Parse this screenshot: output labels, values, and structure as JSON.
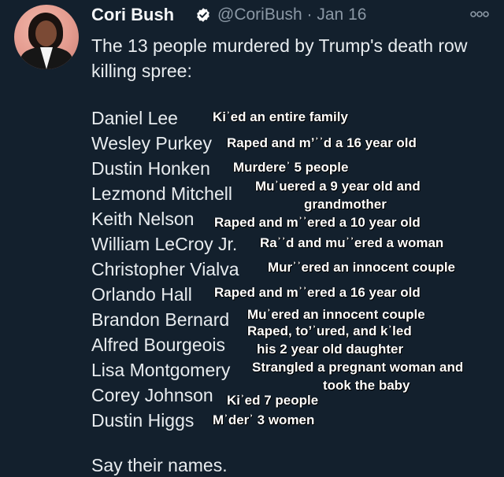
{
  "tweet": {
    "author_name": "Cori Bush",
    "handle": "@CoriBush",
    "separator": "·",
    "date": "Jan 16",
    "intro": "The 13 people murdered by Trump's death row killing spree:",
    "outro": "Say their names."
  },
  "entries": [
    {
      "victim": "Daniel Lee",
      "crime": "Kiʾed an entire family"
    },
    {
      "victim": "Wesley Purkey",
      "crime": "Raped and mʼʾʾd a 16 year old"
    },
    {
      "victim": "Dustin Honken",
      "crime": "Murdereʾ 5 people"
    },
    {
      "victim": "Lezmond Mitchell",
      "crime": "Muʾuered a 9 year old and",
      "crime2": "grandmother"
    },
    {
      "victim": "Keith Nelson",
      "crime": "Raped and mʾʾered a 10 year old"
    },
    {
      "victim": "William LeCroy Jr.",
      "crime": "Raʾʾd and muʾʾered a woman"
    },
    {
      "victim": "Christopher Vialva",
      "crime": "Murʾʾered an innocent couple"
    },
    {
      "victim": "Orlando Hall",
      "crime": "Raped and mʾʾered a 16 year old"
    },
    {
      "victim": "Brandon Bernard",
      "crime": "Muʾered an innocent couple"
    },
    {
      "victim": "Alfred Bourgeois",
      "crime": "Raped, toʼʾured, and kʾled",
      "crime2": "his 2 year old daughter"
    },
    {
      "victim": "Lisa Montgomery",
      "crime": "Strangled a pregnant woman and",
      "crime2": "took the baby"
    },
    {
      "victim": "Corey Johnson",
      "crime": "Kiʾed 7 people"
    },
    {
      "victim": "Dustin Higgs",
      "crime": "Mʾderʾ 3 women"
    }
  ],
  "icons": {
    "verified": "verified-badge-icon",
    "more": "more-options-icon"
  },
  "colors": {
    "background": "#13202d",
    "text": "#e8ecef",
    "muted": "#8b98a5",
    "verified": "#1d9bf0"
  }
}
